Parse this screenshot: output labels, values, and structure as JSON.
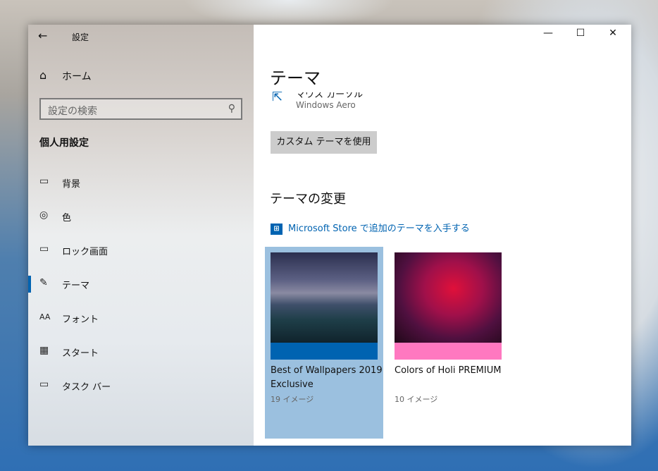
{
  "window": {
    "title": "設定",
    "back_icon": "arrow-left-icon",
    "minimize": "—",
    "maximize": "☐",
    "close": "✕"
  },
  "sidebar": {
    "home": "ホーム",
    "search_placeholder": "設定の検索",
    "section": "個人用設定",
    "items": [
      {
        "label": "背景",
        "icon": "▭"
      },
      {
        "label": "色",
        "icon": "◎"
      },
      {
        "label": "ロック画面",
        "icon": "▭"
      },
      {
        "label": "テーマ",
        "icon": "✎"
      },
      {
        "label": "フォント",
        "icon": "AA"
      },
      {
        "label": "スタート",
        "icon": "▦"
      },
      {
        "label": "タスク バー",
        "icon": "▭"
      }
    ],
    "accent": "#0063b1"
  },
  "main": {
    "title": "テーマ",
    "cursor_label": "マウス カーソル",
    "cursor_value": "Windows Aero",
    "custom_button": "カスタム テーマを使用",
    "change_heading": "テーマの変更",
    "store_link": "Microsoft Store で追加のテーマを入手する",
    "themes": [
      {
        "title": "Best of Wallpapers 2019 Exclusive",
        "count": "19 イメージ",
        "accent": "#0063b1"
      },
      {
        "title": "Colors of Holi PREMIUM",
        "count": "10 イメージ",
        "accent": "#ff78c0"
      }
    ]
  }
}
